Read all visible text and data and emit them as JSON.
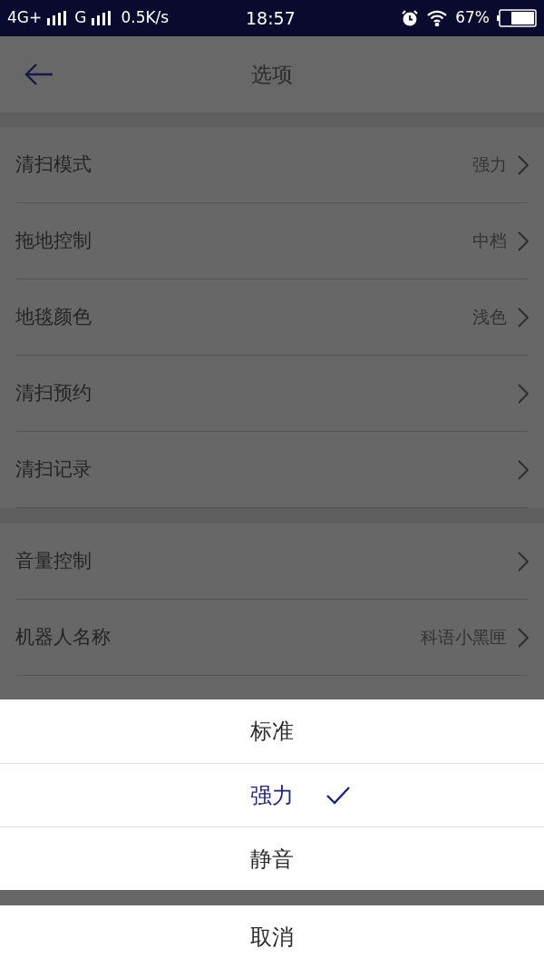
{
  "status_bar": {
    "network_1": "4G+",
    "network_2": "G",
    "speed": "0.5K/s",
    "time": "18:57",
    "battery": "67%"
  },
  "header": {
    "title": "选项"
  },
  "sections": [
    {
      "items": [
        {
          "label": "清扫模式",
          "value": "强力"
        },
        {
          "label": "拖地控制",
          "value": "中档"
        },
        {
          "label": "地毯颜色",
          "value": "浅色"
        },
        {
          "label": "清扫预约"
        },
        {
          "label": "清扫记录"
        }
      ]
    },
    {
      "items": [
        {
          "label": "音量控制"
        },
        {
          "label": "机器人名称",
          "value": "科语小黑匣"
        }
      ]
    }
  ],
  "action_sheet": {
    "options": [
      {
        "label": "标准",
        "selected": false
      },
      {
        "label": "强力",
        "selected": true
      },
      {
        "label": "静音",
        "selected": false
      }
    ],
    "cancel": "取消"
  }
}
